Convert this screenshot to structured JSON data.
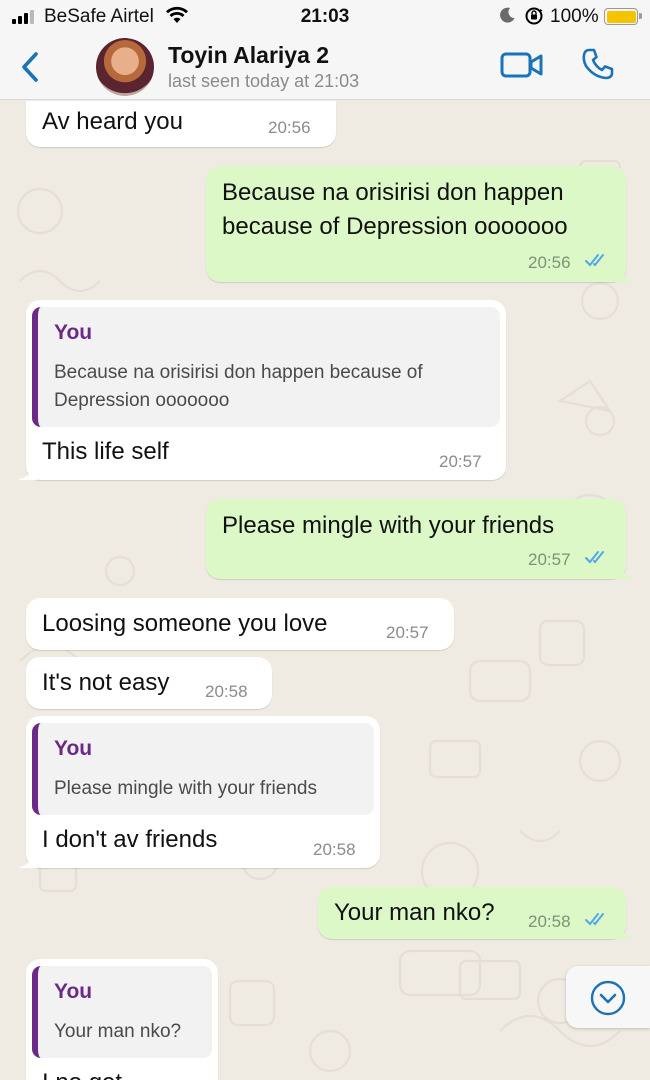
{
  "status_bar": {
    "carrier": "BeSafe Airtel",
    "time": "21:03",
    "battery": "100%",
    "signal_bars": 4,
    "signal_active": 3
  },
  "header": {
    "back_icon": "chevron-left-icon",
    "contact_name": "Toyin Alariya 2",
    "last_seen": "last seen today at 21:03",
    "video_icon": "video-camera-icon",
    "call_icon": "phone-icon",
    "accent": "#1a73b8"
  },
  "messages": [
    {
      "dir": "in",
      "text": "Av heard you",
      "time": "20:56"
    },
    {
      "dir": "out",
      "text_lines": [
        "Because na orisirisi don happen",
        "because of Depression ooooooo"
      ],
      "time": "20:56",
      "ticks": "read"
    },
    {
      "dir": "in",
      "quote": {
        "author": "You",
        "lines": [
          "Because na orisirisi don happen because of",
          "Depression ooooooo"
        ]
      },
      "text": "This life self",
      "time": "20:57"
    },
    {
      "dir": "out",
      "text": "Please mingle with your friends",
      "time": "20:57",
      "ticks": "read"
    },
    {
      "dir": "in",
      "text": "Loosing someone you love",
      "time": "20:57"
    },
    {
      "dir": "in",
      "text": "It's not easy",
      "time": "20:58"
    },
    {
      "dir": "in",
      "quote": {
        "author": "You",
        "lines": [
          "Please mingle with your friends"
        ]
      },
      "text": "I don't av friends",
      "time": "20:58"
    },
    {
      "dir": "out",
      "text": "Your man nko?",
      "time": "20:58",
      "ticks": "read"
    },
    {
      "dir": "in",
      "quote": {
        "author": "You",
        "lines": [
          "Your man nko?"
        ]
      },
      "text": "I no get",
      "time": ""
    }
  ],
  "colors": {
    "chat_bg": "#efeae2",
    "incoming": "#ffffff",
    "outgoing": "#dcf8c6",
    "quote_author": "#6b2a87",
    "read_ticks": "#4fa8e8"
  },
  "scroll_down_icon": "chevron-down-circle-icon"
}
